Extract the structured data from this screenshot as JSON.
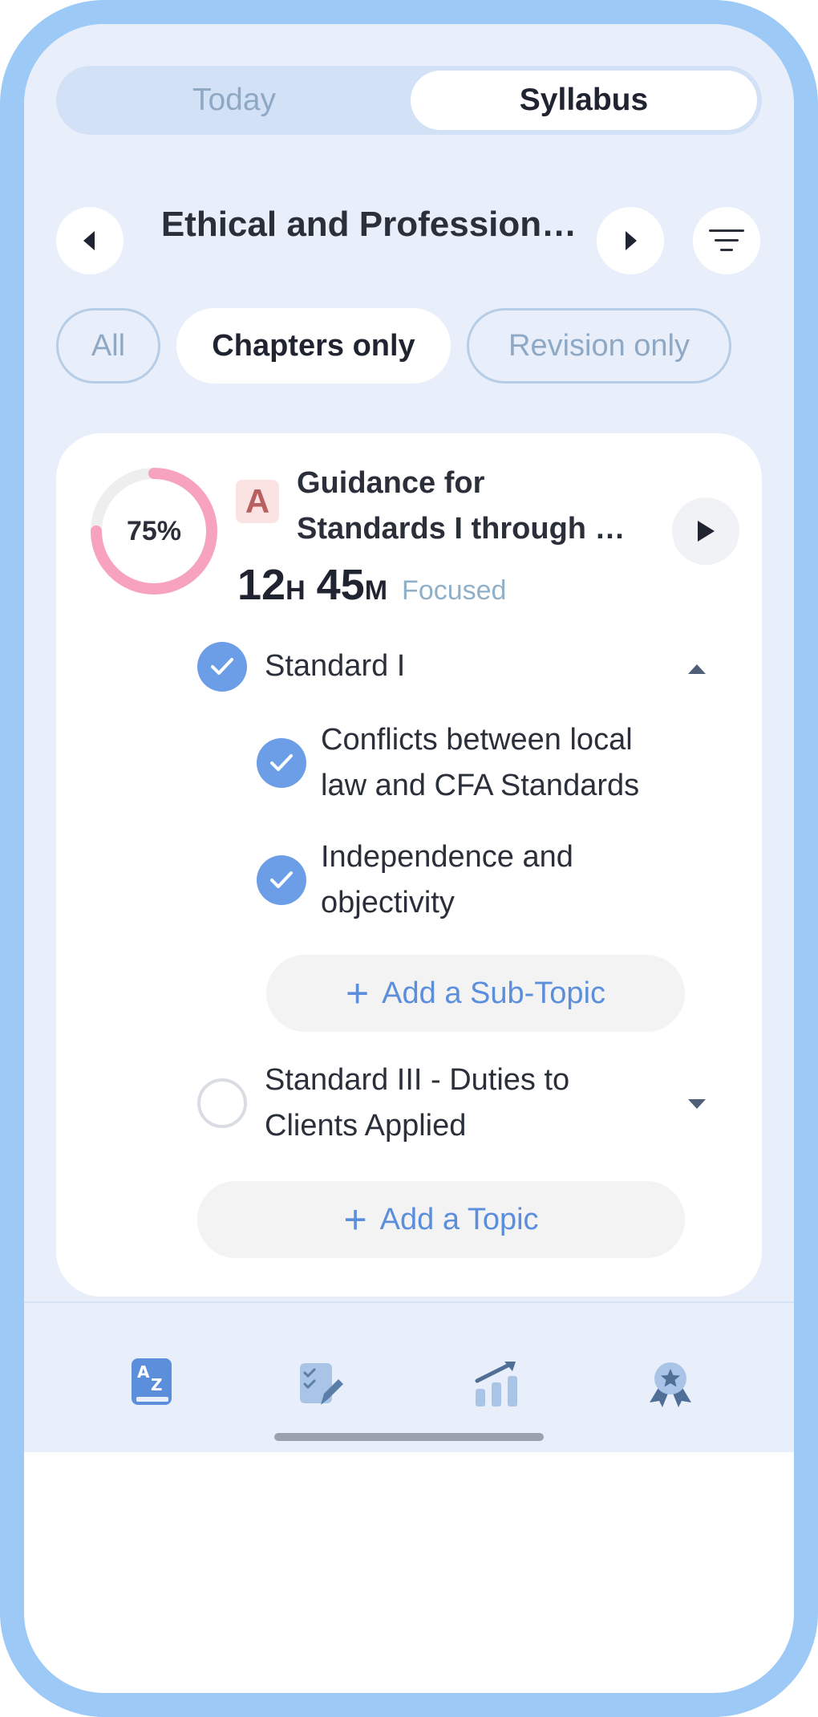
{
  "tabs": {
    "today": "Today",
    "syllabus": "Syllabus"
  },
  "header": {
    "title": "Ethical and Profession…",
    "prev_icon": "chevron-left-icon",
    "next_icon": "chevron-right-icon",
    "filter_icon": "filter-lines-icon"
  },
  "filters": {
    "all": "All",
    "chapters_only": "Chapters only",
    "revision_only": "Revision only",
    "selected": "Chapters only"
  },
  "chapter": {
    "progress_label": "75%",
    "progress_fraction": 0.75,
    "grade": "A",
    "title_line1": "Guidance for",
    "title_line2": "Standards I through …",
    "hours": "12",
    "hours_unit": "H",
    "minutes": "45",
    "minutes_unit": "M",
    "focused_label": "Focused",
    "topics": [
      {
        "label": "Standard I",
        "done": true,
        "expanded": true,
        "subtopics": [
          {
            "line1": "Conflicts between local",
            "line2": "law and CFA Standards",
            "done": true
          },
          {
            "line1": "Independence and",
            "line2": "objectivity",
            "done": true
          }
        ],
        "add_subtopic_label": "Add a Sub-Topic"
      },
      {
        "line1": "Standard III - Duties to",
        "line2": "Clients Applied",
        "done": false,
        "expanded": false
      }
    ],
    "add_topic_label": "Add a Topic"
  },
  "nav": {
    "items": [
      "syllabus-az-icon",
      "tasks-edit-icon",
      "stats-chart-icon",
      "achievements-badge-icon"
    ]
  },
  "colors": {
    "accent": "#6b9ee6",
    "ring": "#f7a3bf",
    "frame": "#9cc9f6",
    "background": "#e8effb"
  }
}
